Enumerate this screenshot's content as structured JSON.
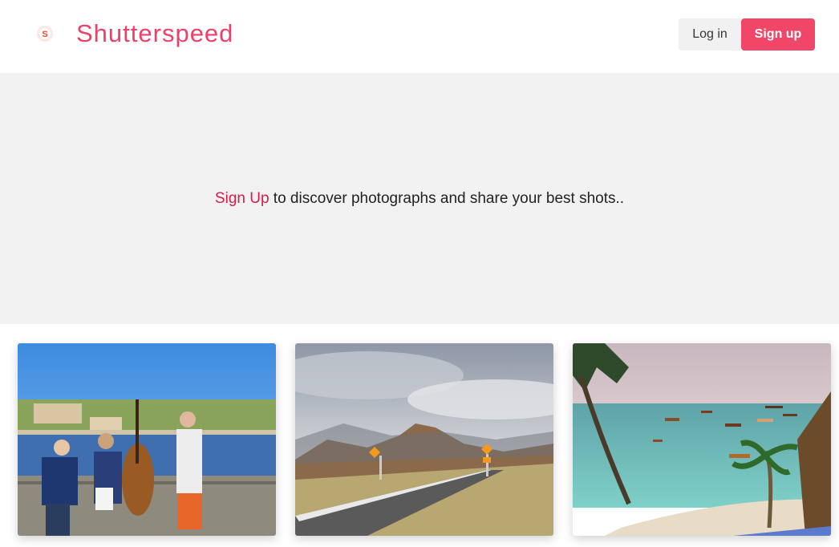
{
  "header": {
    "brand": "Shutterspeed",
    "logo_icon": "shutter-logo-icon",
    "login_label": "Log in",
    "signup_label": "Sign up"
  },
  "hero": {
    "link_text": "Sign Up",
    "text": " to discover photographs and share your best shots.."
  },
  "gallery": {
    "photos": [
      {
        "subject": "street musicians on bridge by river"
      },
      {
        "subject": "mountain road with warning signs"
      },
      {
        "subject": "tropical beach with boats and palm"
      }
    ]
  },
  "colors": {
    "brand": "#ee4069",
    "signup_button": "#f14668",
    "hero_link": "#d81b48",
    "hero_bg": "#f2f2f2"
  }
}
